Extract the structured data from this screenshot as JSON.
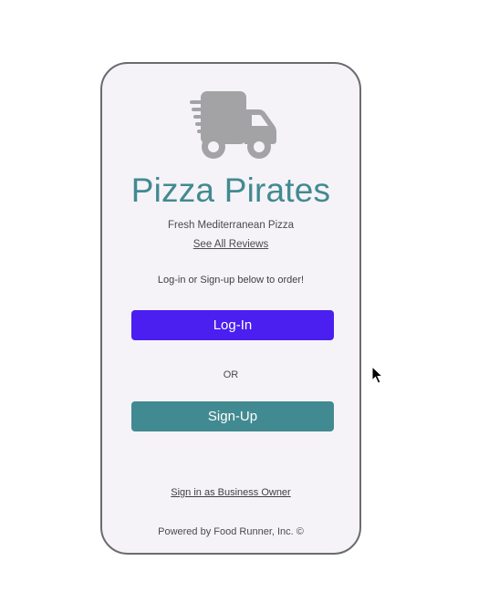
{
  "app": {
    "title": "Pizza Pirates",
    "tagline": "Fresh Mediterranean Pizza",
    "reviews_link": "See All Reviews",
    "instructions": "Log-in or Sign-up below to order!",
    "login_label": "Log-In",
    "or_label": "OR",
    "signup_label": "Sign-Up",
    "business_link": "Sign in as Business Owner",
    "footer": "Powered by Food Runner, Inc. ©"
  },
  "icons": {
    "logo": "delivery-truck-icon",
    "pointer": "mouse-cursor-icon"
  },
  "colors": {
    "brand_teal": "#428a91",
    "login_purple": "#4a1ff0",
    "icon_gray": "#a3a3a6",
    "card_background": "#f5f3f7"
  }
}
